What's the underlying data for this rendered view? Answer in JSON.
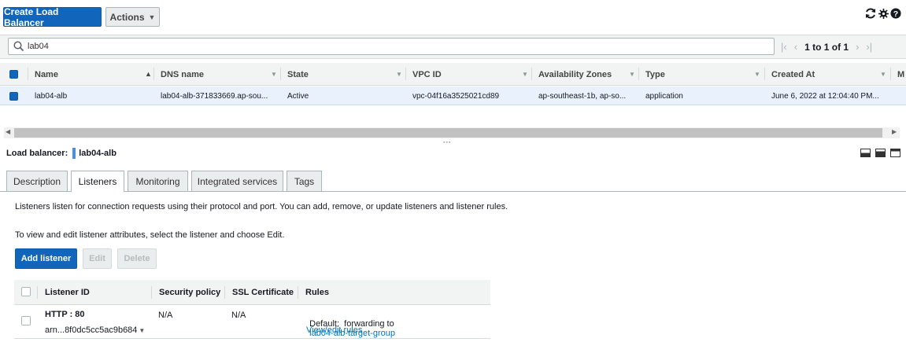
{
  "toolbar": {
    "create_label": "Create Load Balancer",
    "actions_label": "Actions"
  },
  "filter": {
    "search_value": "lab04",
    "pagination_text": "1 to 1 of 1"
  },
  "table": {
    "columns": [
      "Name",
      "DNS name",
      "State",
      "VPC ID",
      "Availability Zones",
      "Type",
      "Created At",
      "M"
    ],
    "rows": [
      {
        "name": "lab04-alb",
        "dns": "lab04-alb-371833669.ap-sou...",
        "state": "Active",
        "vpc": "vpc-04f16a3525021cd89",
        "az": "ap-southeast-1b, ap-so...",
        "type": "application",
        "created": "June 6, 2022 at 12:04:40 PM..."
      }
    ]
  },
  "detail": {
    "label": "Load balancer:",
    "value": "lab04-alb",
    "tabs": [
      "Description",
      "Listeners",
      "Monitoring",
      "Integrated services",
      "Tags"
    ],
    "active_tab": "Listeners",
    "intro": "Listeners listen for connection requests using their protocol and port. You can add, remove, or update listeners and listener rules.",
    "instruction": "To view and edit listener attributes, select the listener and choose Edit.",
    "buttons": {
      "add": "Add listener",
      "edit": "Edit",
      "delete": "Delete"
    },
    "listener_table": {
      "headers": [
        "Listener ID",
        "Security policy",
        "SSL Certificate",
        "Rules"
      ],
      "row": {
        "listener_id": "HTTP : 80",
        "arn": "arn...8f0dc5cc5ac9b684",
        "security_policy": "N/A",
        "ssl_certificate": "N/A",
        "rules_prefix": "Default:  forwarding to",
        "target_group": "lab04-alb-target-group",
        "view_rules": "View/edit rules"
      }
    }
  },
  "colors": {
    "primary": "#1166bb",
    "link": "#0073bb",
    "selected_row": "#e8f1fc"
  }
}
